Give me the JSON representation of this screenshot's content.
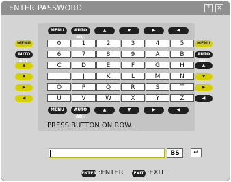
{
  "title": "ENTER PASSWORD",
  "title_buttons": {
    "help": "?",
    "close": "✕"
  },
  "nav_pills": {
    "menu": "MENU",
    "auto_adj": "AUTO ADJ."
  },
  "keys": [
    [
      "0",
      "1",
      "2",
      "3",
      "4",
      "5"
    ],
    [
      "6",
      "7",
      "8",
      "9",
      "A",
      "B"
    ],
    [
      "C",
      "D",
      "E",
      "F",
      "G",
      "H"
    ],
    [
      "I",
      "J",
      "K",
      "L",
      "M",
      "N"
    ],
    [
      "O",
      "P",
      "Q",
      "R",
      "S",
      "T"
    ],
    [
      "U",
      "V",
      "W",
      "X",
      "Y",
      "Z"
    ]
  ],
  "message": "PRESS BUTTON ON ROW.",
  "bs_label": "BS",
  "return_label": "↵",
  "footer": {
    "enter_badge": "ENTER",
    "enter_label": ":ENTER",
    "exit_badge": "EXIT",
    "exit_label": ":EXIT"
  },
  "colors": {
    "highlight": "#d7d000",
    "titlebar": "#8f8f8f"
  }
}
